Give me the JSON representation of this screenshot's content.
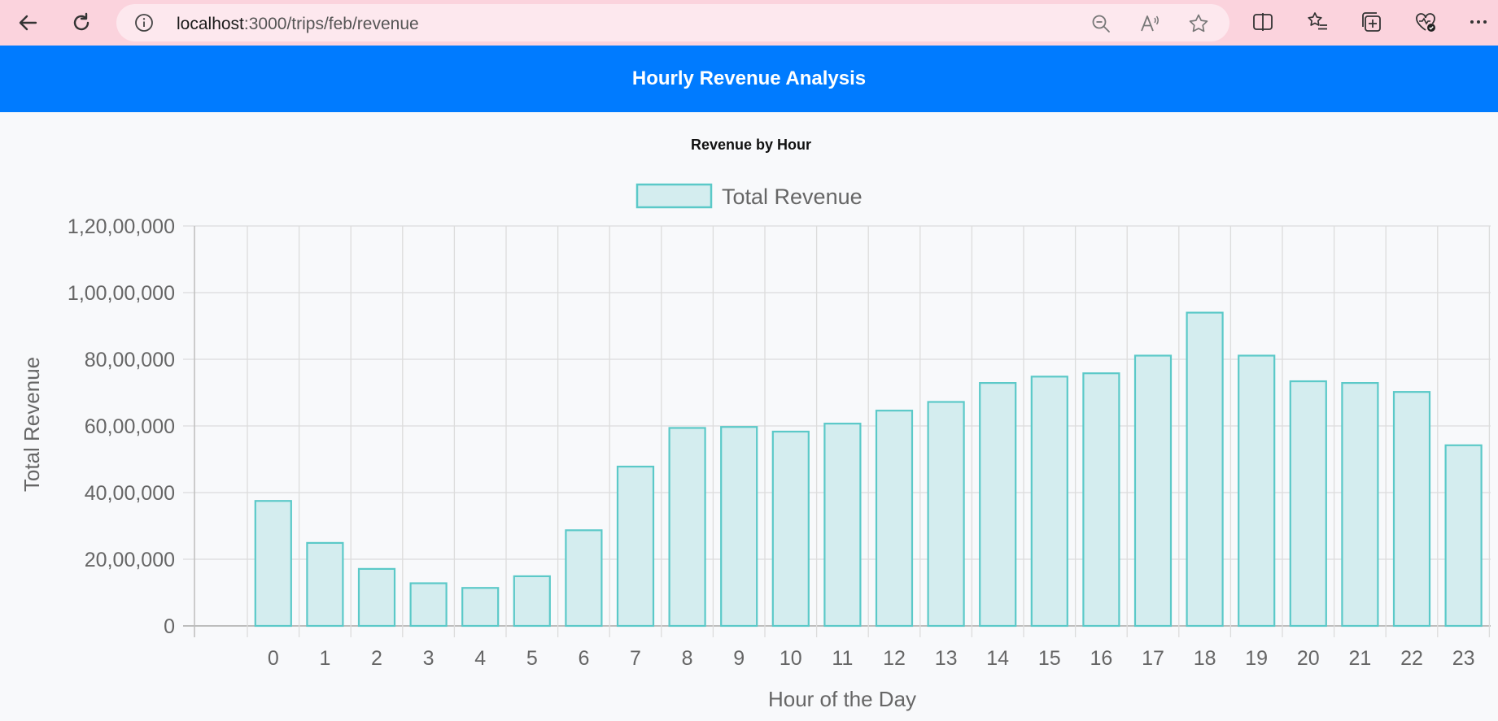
{
  "browser": {
    "url_host": "localhost",
    "url_path": ":3000/trips/feb/revenue",
    "icons": [
      "back-icon",
      "refresh-icon",
      "info-icon",
      "zoom-out-icon",
      "read-aloud-icon",
      "favorite-star-icon",
      "split-screen-icon",
      "favorites-icon",
      "collections-icon",
      "browser-essentials-icon",
      "more-icon"
    ]
  },
  "header": {
    "title": "Hourly Revenue Analysis",
    "background": "#007bff"
  },
  "chart_data": {
    "type": "bar",
    "title": "Revenue by Hour",
    "legend": [
      "Total Revenue"
    ],
    "legend_position": "top",
    "xlabel": "Hour of the Day",
    "ylabel": "Total Revenue",
    "categories": [
      "0",
      "1",
      "2",
      "3",
      "4",
      "5",
      "6",
      "7",
      "8",
      "9",
      "10",
      "11",
      "12",
      "13",
      "14",
      "15",
      "16",
      "17",
      "18",
      "19",
      "20",
      "21",
      "22",
      "23"
    ],
    "series": [
      {
        "name": "Total Revenue",
        "values": [
          3750000,
          2490000,
          1710000,
          1280000,
          1140000,
          1490000,
          2870000,
          4780000,
          5940000,
          5970000,
          5830000,
          6070000,
          6460000,
          6720000,
          7290000,
          7480000,
          7580000,
          8110000,
          9400000,
          8110000,
          7340000,
          7290000,
          7020000,
          5420000
        ],
        "fill": "#d4edef",
        "stroke": "#5bc9c8"
      }
    ],
    "ylim": [
      0,
      12000000
    ],
    "yticks": [
      0,
      2000000,
      4000000,
      6000000,
      8000000,
      10000000,
      12000000
    ],
    "ytick_labels": [
      "0",
      "20,00,000",
      "40,00,000",
      "60,00,000",
      "80,00,000",
      "1,00,00,000",
      "1,20,00,000"
    ],
    "grid": true
  }
}
